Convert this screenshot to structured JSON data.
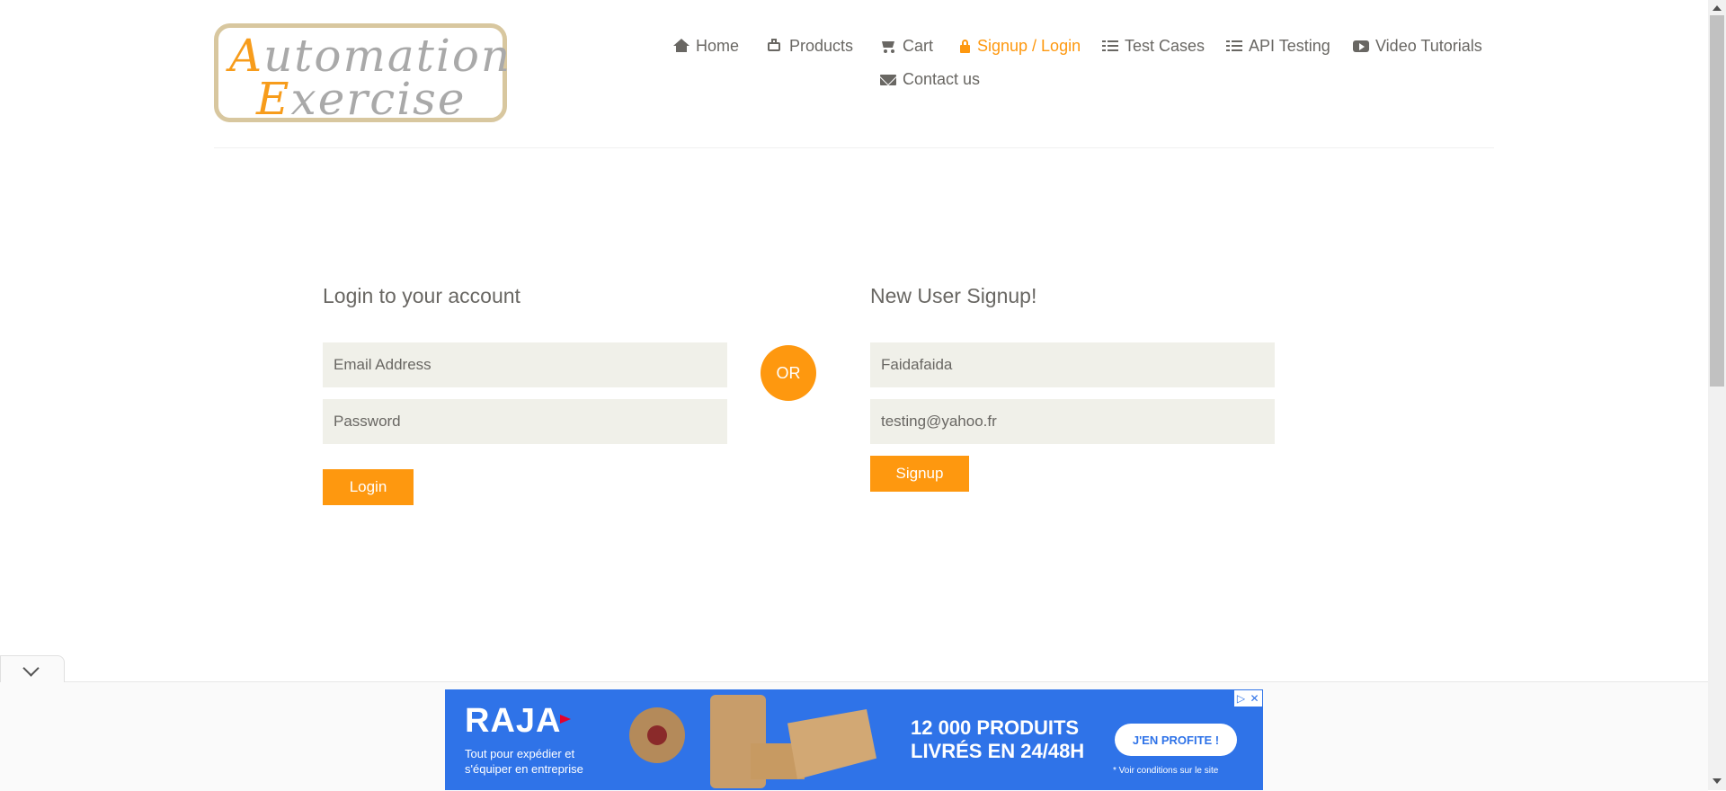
{
  "logo": {
    "line1_cap": "A",
    "line1_rest": "utomation",
    "line2_cap": "E",
    "line2_rest": "xercise"
  },
  "nav": {
    "home": "Home",
    "products": "Products",
    "cart": "Cart",
    "signup_login": "Signup / Login",
    "test_cases": "Test Cases",
    "api_testing": "API Testing",
    "video_tutorials": "Video Tutorials",
    "contact_us": "Contact us"
  },
  "login": {
    "title": "Login to your account",
    "email_placeholder": "Email Address",
    "password_placeholder": "Password",
    "button": "Login"
  },
  "or_label": "OR",
  "signup": {
    "title": "New User Signup!",
    "name_value": "Faidafaida",
    "email_value": "testing@yahoo.fr",
    "button": "Signup"
  },
  "ad": {
    "brand": "RAJA",
    "tagline_1": "Tout pour expédier et",
    "tagline_2": "s'équiper en entreprise",
    "headline_1": "12 000 PRODUITS",
    "headline_2": "LIVRÉS EN 24/48H",
    "cta": "J'EN PROFITE !",
    "conditions": "* Voir conditions sur le site"
  },
  "colors": {
    "accent": "#fe980f",
    "text": "#696763",
    "field_bg": "#f0f0e9",
    "ad_blue": "#2f73e8"
  }
}
